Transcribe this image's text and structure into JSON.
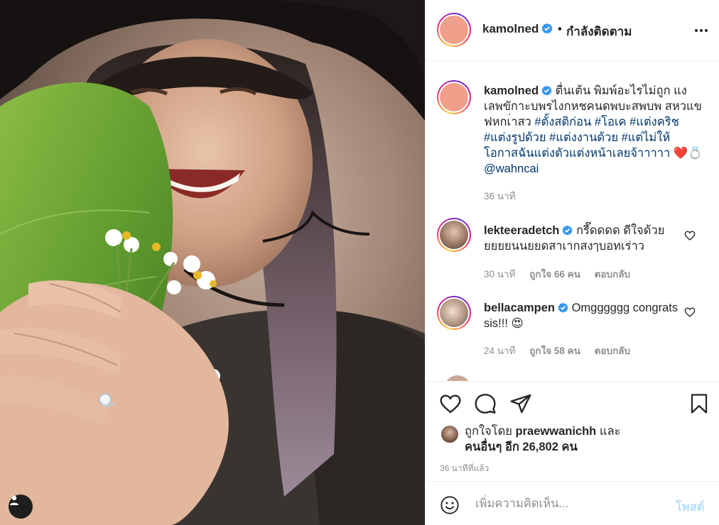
{
  "post": {
    "username": "kamolned",
    "follow_sep": "•",
    "follow_status": "กำลังติดตาม"
  },
  "caption": {
    "username": "kamolned",
    "text": "ตื่นเต้น พิมพ์อะไรไม่ถูก แงเลพขักาะบพรไงกหชคนดพบะสพบพ สหวแข ฟหกเ่าสว",
    "hashtags": [
      "#ตั้งสติก่อน",
      "#โอเค",
      "#แต่งคริช",
      "#แต่งรูปด้วย",
      "#แต่งงานด้วย",
      "#แต่ไม่ให้โอกาสฉันแต่งตัวแต่งหน้าเลยจ้า"
    ],
    "tail": "าาาา",
    "emoji": "❤️💍",
    "mention": "@wahncai",
    "time": "36 นาที"
  },
  "comments": [
    {
      "username": "lekteeradetch",
      "text": "กรี๊ดดดด ดีใจด้วย ยยยยนนยยดสาเากสงๅบอทเร่าว",
      "time": "30 นาที",
      "likes": "ถูกใจ 66 คน",
      "reply": "ตอบกลับ"
    },
    {
      "username": "bellacampen",
      "text": "Omgggggg congrats sis!!! 😍",
      "time": "24 นาที",
      "likes": "ถูกใจ 58 คน",
      "reply": "ตอบกลับ"
    }
  ],
  "likes": {
    "prefix": "ถูกใจโดย",
    "user": "praewwanichh",
    "conj": "และ",
    "others": "คนอื่นๆ อีก 26,802 คน"
  },
  "posted_ago": "36 นาทีที่แล้ว",
  "composer": {
    "placeholder": "เพิ่มความคิดเห็น...",
    "post_label": "โพสต์"
  },
  "icons": {
    "verified": "verified-badge-icon",
    "more": "more-options-icon",
    "like": "heart-icon",
    "comment": "comment-bubble-icon",
    "share": "paper-plane-icon",
    "save": "bookmark-icon",
    "emoji": "smiley-icon",
    "tag": "person-icon"
  },
  "colors": {
    "link": "#00376b",
    "verified": "#3897f0",
    "muted": "#8e8e8e",
    "post_disabled": "#b2dffc"
  }
}
